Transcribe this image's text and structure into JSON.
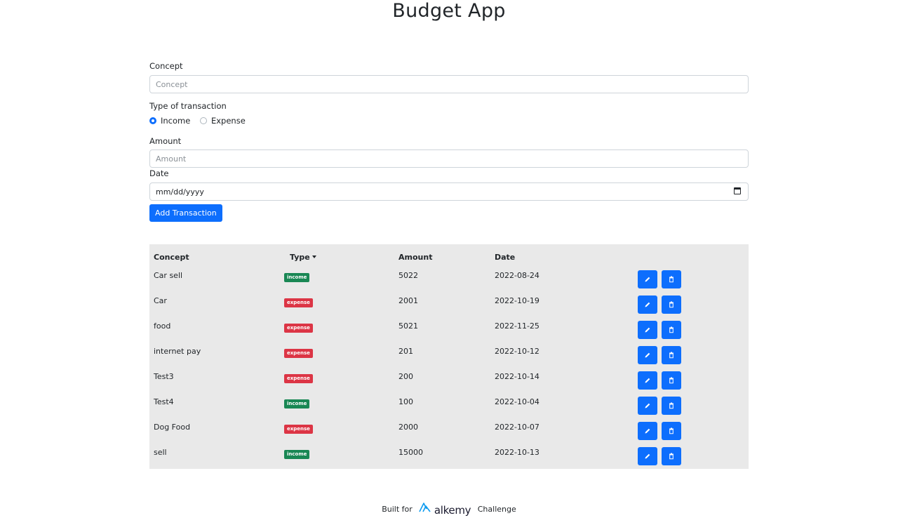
{
  "app": {
    "title": "Budget App"
  },
  "form": {
    "concept_label": "Concept",
    "concept_placeholder": "Concept",
    "type_label": "Type of transaction",
    "type_options": [
      "Income",
      "Expense"
    ],
    "type_selected": "Income",
    "amount_label": "Amount",
    "amount_placeholder": "Amount",
    "date_label": "Date",
    "date_value": "mm/dd/yyyy",
    "submit_label": "Add Transaction"
  },
  "table": {
    "headers": {
      "concept": "Concept",
      "type": "Type",
      "amount": "Amount",
      "date": "Date"
    },
    "rows": [
      {
        "concept": "Car sell",
        "type": "income",
        "amount": "5022",
        "date": "2022-08-24"
      },
      {
        "concept": "Car",
        "type": "expense",
        "amount": "2001",
        "date": "2022-10-19"
      },
      {
        "concept": "food",
        "type": "expense",
        "amount": "5021",
        "date": "2022-11-25"
      },
      {
        "concept": "internet pay",
        "type": "expense",
        "amount": "201",
        "date": "2022-10-12"
      },
      {
        "concept": "Test3",
        "type": "expense",
        "amount": "200",
        "date": "2022-10-14"
      },
      {
        "concept": "Test4",
        "type": "income",
        "amount": "100",
        "date": "2022-10-04"
      },
      {
        "concept": "Dog Food",
        "type": "expense",
        "amount": "2000",
        "date": "2022-10-07"
      },
      {
        "concept": "sell",
        "type": "income",
        "amount": "15000",
        "date": "2022-10-13"
      }
    ],
    "row_icons": [
      "pencil-icon",
      "trash-icon"
    ]
  },
  "footer": {
    "prefix": "Built for",
    "brand": "alkemy",
    "suffix": "Challenge"
  },
  "colors": {
    "primary": "#0d6efd",
    "income": "#198754",
    "expense": "#dc3545",
    "table_bg": "#e9e9e9"
  }
}
